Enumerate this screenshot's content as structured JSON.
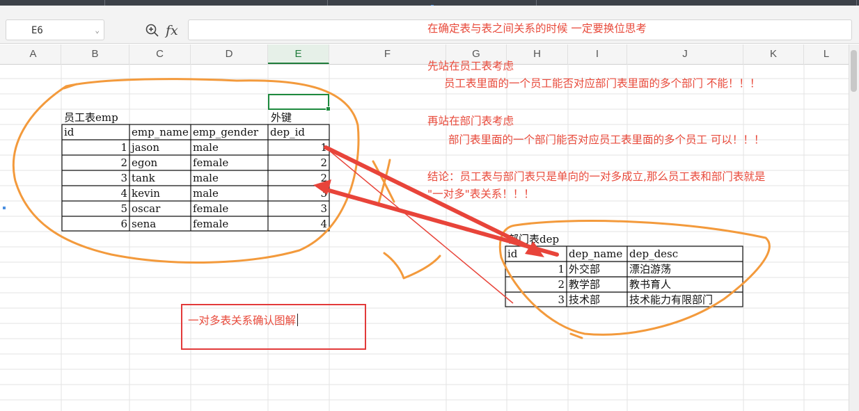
{
  "formula_bar": {
    "name_box": "E6",
    "fx_label": "fx",
    "formula_value": ""
  },
  "columns": [
    "A",
    "B",
    "C",
    "D",
    "E",
    "F",
    "G",
    "H",
    "I",
    "J",
    "K",
    "L"
  ],
  "active_column": "E",
  "emp_table": {
    "title": "员工表emp",
    "fk_label": "外键",
    "headers": [
      "id",
      "emp_name",
      "emp_gender",
      "dep_id"
    ],
    "rows": [
      {
        "id": "1",
        "name": "jason",
        "gender": "male",
        "dep_id": "1"
      },
      {
        "id": "2",
        "name": "egon",
        "gender": "female",
        "dep_id": "2"
      },
      {
        "id": "3",
        "name": "tank",
        "gender": "male",
        "dep_id": "2"
      },
      {
        "id": "4",
        "name": "kevin",
        "gender": "male",
        "dep_id": "3"
      },
      {
        "id": "5",
        "name": "oscar",
        "gender": "female",
        "dep_id": "3"
      },
      {
        "id": "6",
        "name": "sena",
        "gender": "female",
        "dep_id": "4"
      }
    ]
  },
  "dep_table": {
    "title": "部门表dep",
    "headers": [
      "id",
      "dep_name",
      "dep_desc"
    ],
    "rows": [
      {
        "id": "1",
        "name": "外交部",
        "desc": "漂泊游荡"
      },
      {
        "id": "2",
        "name": "教学部",
        "desc": "教书育人"
      },
      {
        "id": "3",
        "name": "技术部",
        "desc": "技术能力有限部门"
      }
    ]
  },
  "notes": {
    "line1": "在确定表与表之间关系的时候 一定要换位思考",
    "line2": "先站在员工表考虑",
    "line3": "员工表里面的一个员工能否对应部门表里面的多个部门  不能！！！",
    "line4": "再站在部门表考虑",
    "line5": "部门表里面的一个部门能否对应员工表里面的多个员工  可以！！！",
    "line6": "结论：员工表与部门表只是单向的一对多成立,那么员工表和部门表就是",
    "line7": "\"一对多\"表关系！！！"
  },
  "textbox": {
    "text": "一对多表关系确认图解"
  },
  "colors": {
    "note_red": "#e84a3b",
    "orange_ink": "#f39a3c",
    "arrow_red": "#e8443a",
    "active_green": "#1e8a3e"
  },
  "icons": [
    "zoom-formula-icon",
    "fx-icon",
    "chevron-down-icon"
  ]
}
